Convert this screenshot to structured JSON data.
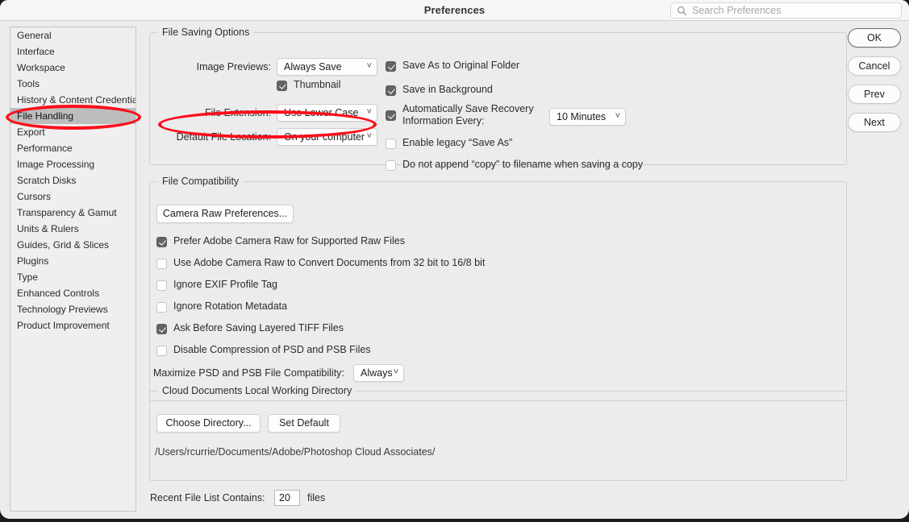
{
  "window": {
    "title": "Preferences",
    "search": {
      "placeholder": "Search Preferences",
      "icon": "search-icon",
      "value": ""
    }
  },
  "sidebar": {
    "selected": "File Handling",
    "items": [
      {
        "label": "General"
      },
      {
        "label": "Interface"
      },
      {
        "label": "Workspace"
      },
      {
        "label": "Tools"
      },
      {
        "label": "History & Content Credentials"
      },
      {
        "label": "File Handling"
      },
      {
        "label": "Export"
      },
      {
        "label": "Performance"
      },
      {
        "label": "Image Processing"
      },
      {
        "label": "Scratch Disks"
      },
      {
        "label": "Cursors"
      },
      {
        "label": "Transparency & Gamut"
      },
      {
        "label": "Units & Rulers"
      },
      {
        "label": "Guides, Grid & Slices"
      },
      {
        "label": "Plugins"
      },
      {
        "label": "Type"
      },
      {
        "label": "Enhanced Controls"
      },
      {
        "label": "Technology Previews"
      },
      {
        "label": "Product Improvement"
      }
    ]
  },
  "file_saving_options": {
    "legend": "File Saving Options",
    "image_previews_label": "Image Previews:",
    "image_previews_value": "Always Save",
    "thumbnail_label": "Thumbnail",
    "thumbnail_checked": true,
    "file_extension_label": "File Extension:",
    "file_extension_value": "Use Lower Case",
    "default_file_location_label": "Default File Location:",
    "default_file_location_value": "On your computer",
    "save_as_original_label": "Save As to Original Folder",
    "save_as_original_checked": true,
    "save_background_label": "Save in Background",
    "save_background_checked": true,
    "autosave_label_line1": "Automatically Save Recovery",
    "autosave_label_line2": "Information Every:",
    "autosave_checked": true,
    "autosave_interval_value": "10 Minutes",
    "legacy_save_as_label": "Enable legacy “Save As”",
    "legacy_save_as_checked": false,
    "no_copy_suffix_label": "Do not append “copy” to filename when saving a copy",
    "no_copy_suffix_checked": false
  },
  "file_compatibility": {
    "legend": "File Compatibility",
    "camera_raw_button": "Camera Raw Preferences...",
    "options": [
      {
        "label": "Prefer Adobe Camera Raw for Supported Raw Files",
        "checked": true
      },
      {
        "label": "Use Adobe Camera Raw to Convert Documents from 32 bit to 16/8 bit",
        "checked": false
      },
      {
        "label": "Ignore EXIF Profile Tag",
        "checked": false
      },
      {
        "label": "Ignore Rotation Metadata",
        "checked": false
      },
      {
        "label": "Ask Before Saving Layered TIFF Files",
        "checked": true
      },
      {
        "label": "Disable Compression of PSD and PSB Files",
        "checked": false
      }
    ],
    "maximize_label": "Maximize PSD and PSB File Compatibility:",
    "maximize_value": "Always"
  },
  "cloud_documents": {
    "legend": "Cloud Documents Local Working Directory",
    "choose_directory_button": "Choose Directory...",
    "set_default_button": "Set Default",
    "path": "/Users/rcurrie/Documents/Adobe/Photoshop Cloud Associates/"
  },
  "recent_files": {
    "label": "Recent File List Contains:",
    "value": "20",
    "unit": "files"
  },
  "actions": {
    "ok": "OK",
    "cancel": "Cancel",
    "prev": "Prev",
    "next": "Next"
  },
  "colors": {
    "annotation": "#fc0d1b",
    "selection": "#bdbdbd",
    "dialog_bg": "#ececec"
  }
}
